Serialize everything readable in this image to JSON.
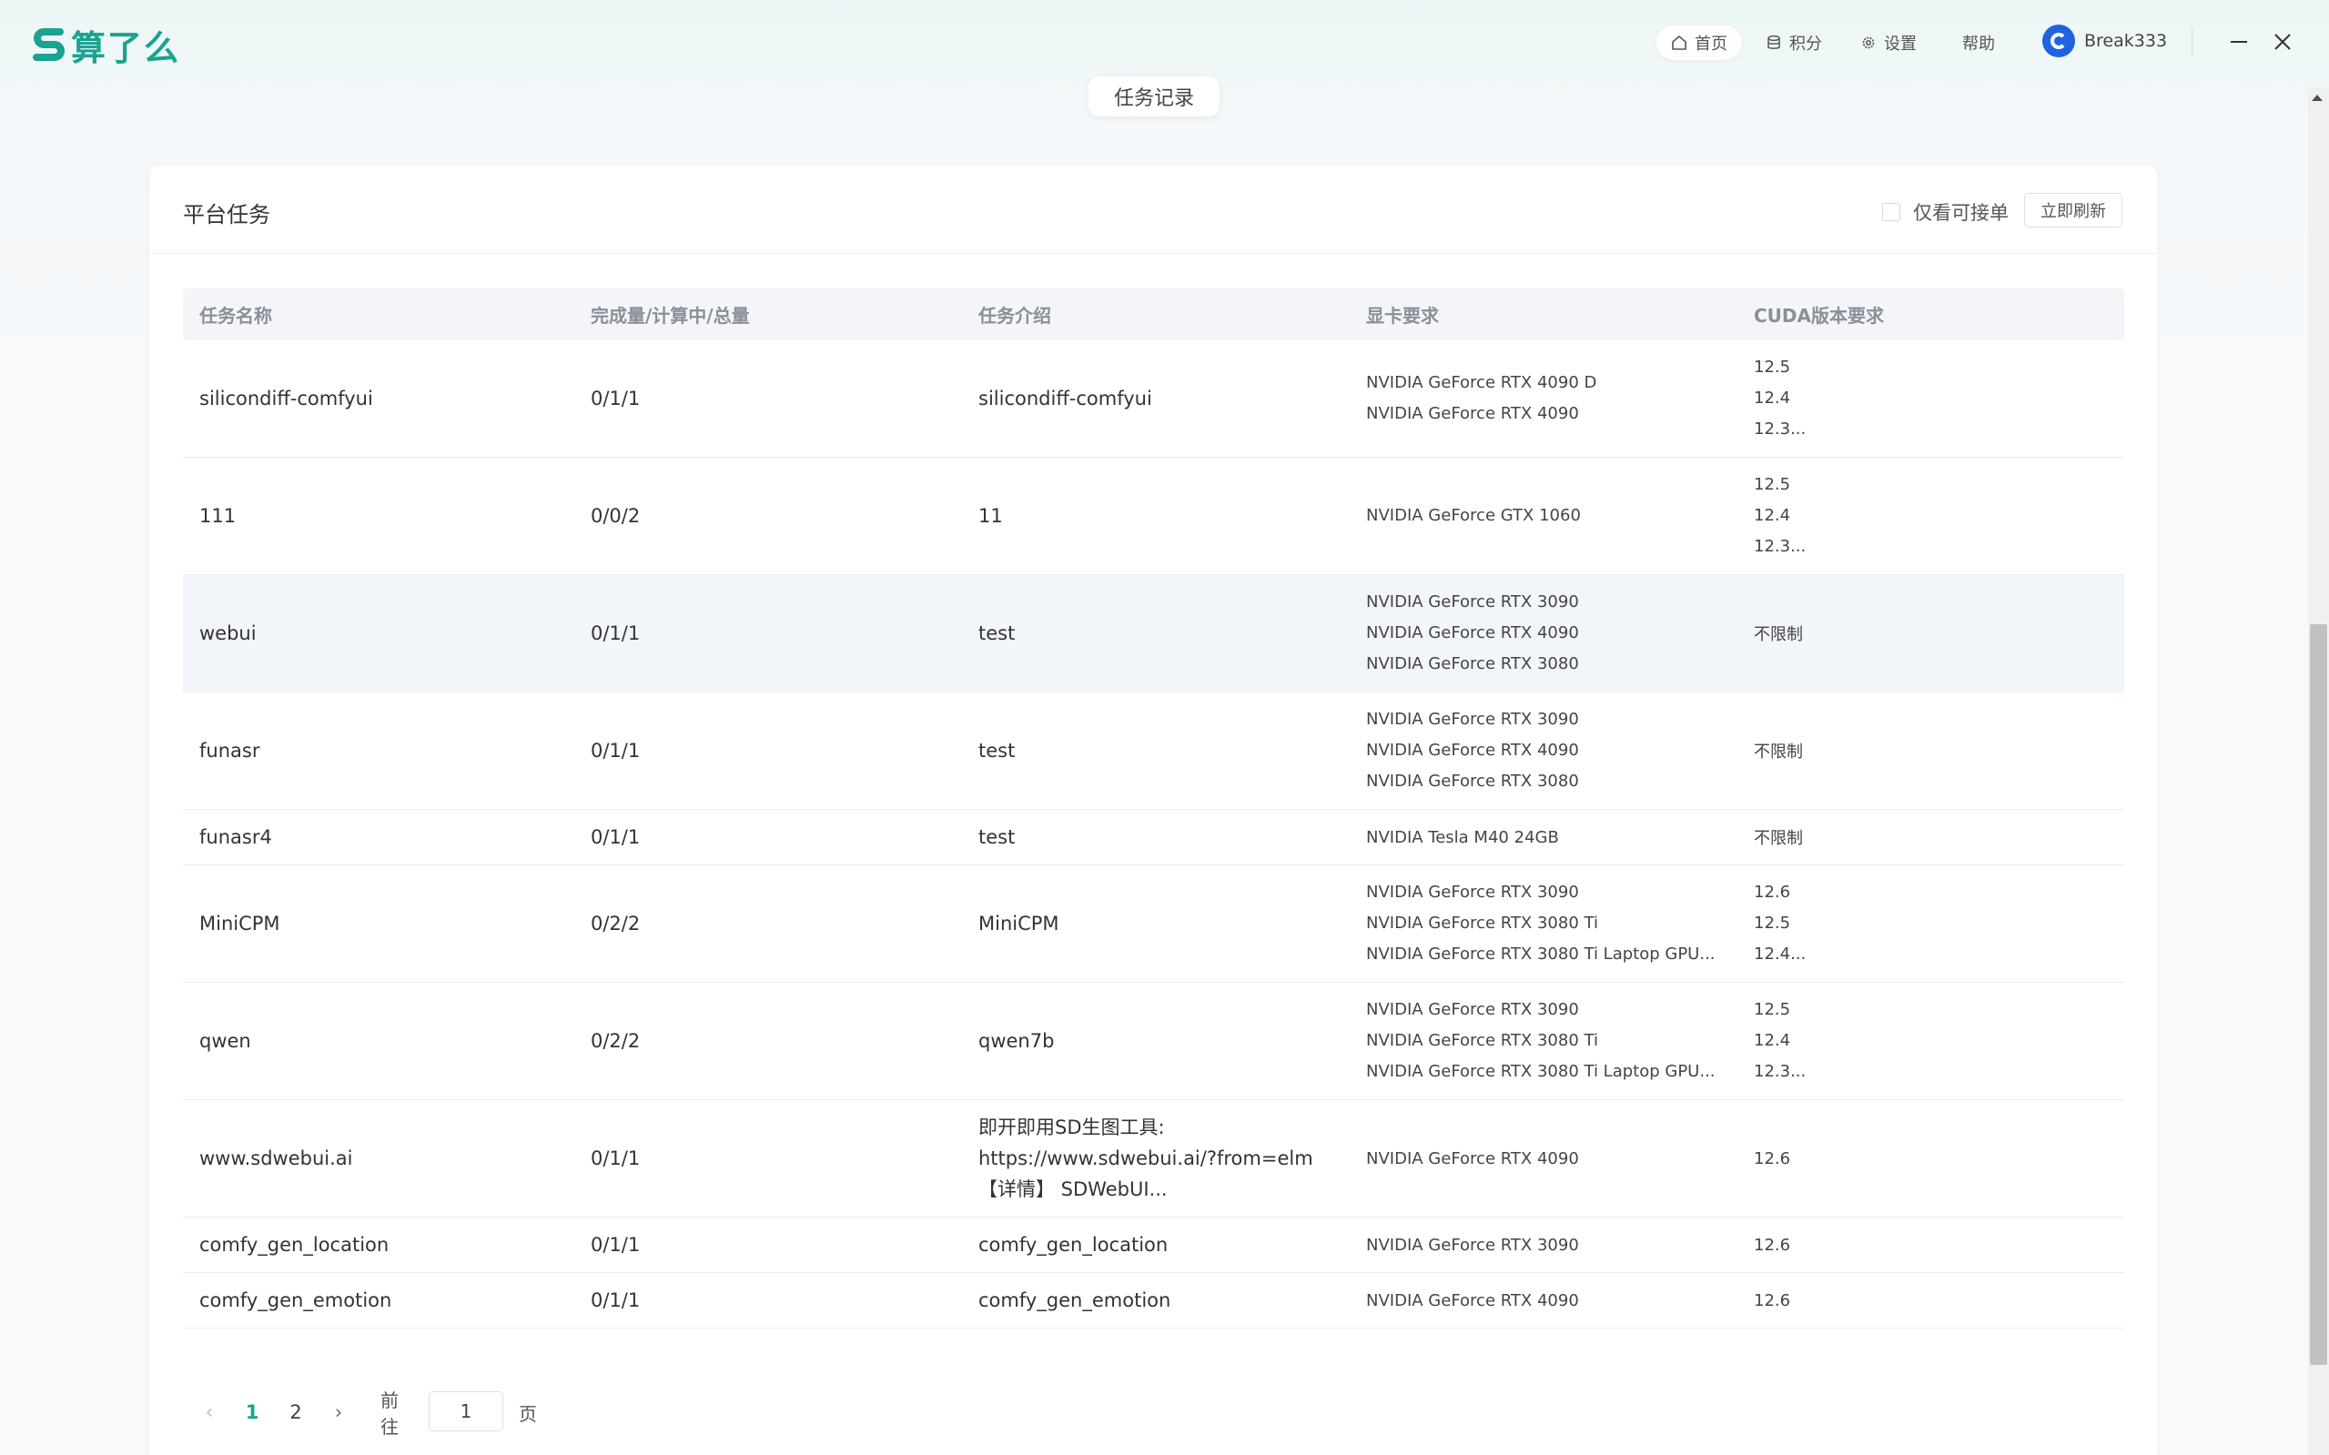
{
  "app": {
    "logo_text": "算了么",
    "brand_color": "#1aa38f"
  },
  "nav": {
    "items": [
      {
        "label": "首页",
        "icon": "home-icon"
      },
      {
        "label": "积分",
        "icon": "database-icon"
      },
      {
        "label": "设置",
        "icon": "gear-icon"
      },
      {
        "label": "帮助",
        "icon": ""
      }
    ],
    "user_name": "Break333"
  },
  "record_tab": "任务记录",
  "card": {
    "title": "平台任务",
    "only_accept_label": "仅看可接单",
    "refresh_label": "立即刷新"
  },
  "table": {
    "headers": [
      "任务名称",
      "完成量/计算中/总量",
      "任务介绍",
      "显卡要求",
      "CUDA版本要求"
    ],
    "rows": [
      {
        "name": "silicondiff-comfyui",
        "progress": "0/1/1",
        "intro": [
          "silicondiff-comfyui"
        ],
        "gpu": [
          "NVIDIA GeForce RTX 4090 D",
          "NVIDIA GeForce RTX 4090"
        ],
        "cuda": [
          "12.5",
          "12.4",
          "12.3..."
        ]
      },
      {
        "name": "111",
        "progress": "0/0/2",
        "intro": [
          "11"
        ],
        "gpu": [
          "NVIDIA GeForce GTX 1060"
        ],
        "cuda": [
          "12.5",
          "12.4",
          "12.3..."
        ]
      },
      {
        "name": "webui",
        "progress": "0/1/1",
        "intro": [
          "test"
        ],
        "gpu": [
          "NVIDIA GeForce RTX 3090",
          "NVIDIA GeForce RTX 4090",
          "NVIDIA GeForce RTX 3080"
        ],
        "cuda": [
          "不限制"
        ]
      },
      {
        "name": "funasr",
        "progress": "0/1/1",
        "intro": [
          "test"
        ],
        "gpu": [
          "NVIDIA GeForce RTX 3090",
          "NVIDIA GeForce RTX 4090",
          "NVIDIA GeForce RTX 3080"
        ],
        "cuda": [
          "不限制"
        ]
      },
      {
        "name": "funasr4",
        "progress": "0/1/1",
        "intro": [
          "test"
        ],
        "gpu": [
          "NVIDIA Tesla M40 24GB"
        ],
        "cuda": [
          "不限制"
        ]
      },
      {
        "name": "MiniCPM",
        "progress": "0/2/2",
        "intro": [
          "MiniCPM"
        ],
        "gpu": [
          "NVIDIA GeForce RTX 3090",
          "NVIDIA GeForce RTX 3080 Ti",
          "NVIDIA GeForce RTX 3080 Ti Laptop GPU..."
        ],
        "cuda": [
          "12.6",
          "12.5",
          "12.4..."
        ]
      },
      {
        "name": "qwen",
        "progress": "0/2/2",
        "intro": [
          "qwen7b"
        ],
        "gpu": [
          "NVIDIA GeForce RTX 3090",
          "NVIDIA GeForce RTX 3080 Ti",
          "NVIDIA GeForce RTX 3080 Ti Laptop GPU..."
        ],
        "cuda": [
          "12.5",
          "12.4",
          "12.3..."
        ]
      },
      {
        "name": "www.sdwebui.ai",
        "progress": "0/1/1",
        "intro": [
          "即开即用SD生图工具:",
          "https://www.sdwebui.ai/?from=elm",
          "【详情】 SDWebUI..."
        ],
        "gpu": [
          "NVIDIA GeForce RTX 4090"
        ],
        "cuda": [
          "12.6"
        ]
      },
      {
        "name": "comfy_gen_location",
        "progress": "0/1/1",
        "intro": [
          "comfy_gen_location"
        ],
        "gpu": [
          "NVIDIA GeForce RTX 3090"
        ],
        "cuda": [
          "12.6"
        ]
      },
      {
        "name": "comfy_gen_emotion",
        "progress": "0/1/1",
        "intro": [
          "comfy_gen_emotion"
        ],
        "gpu": [
          "NVIDIA GeForce RTX 4090"
        ],
        "cuda": [
          "12.6"
        ]
      }
    ]
  },
  "pagination": {
    "pages": [
      "1",
      "2"
    ],
    "current": "1",
    "goto_prefix": "前往",
    "goto_value": "1",
    "goto_suffix": "页"
  }
}
